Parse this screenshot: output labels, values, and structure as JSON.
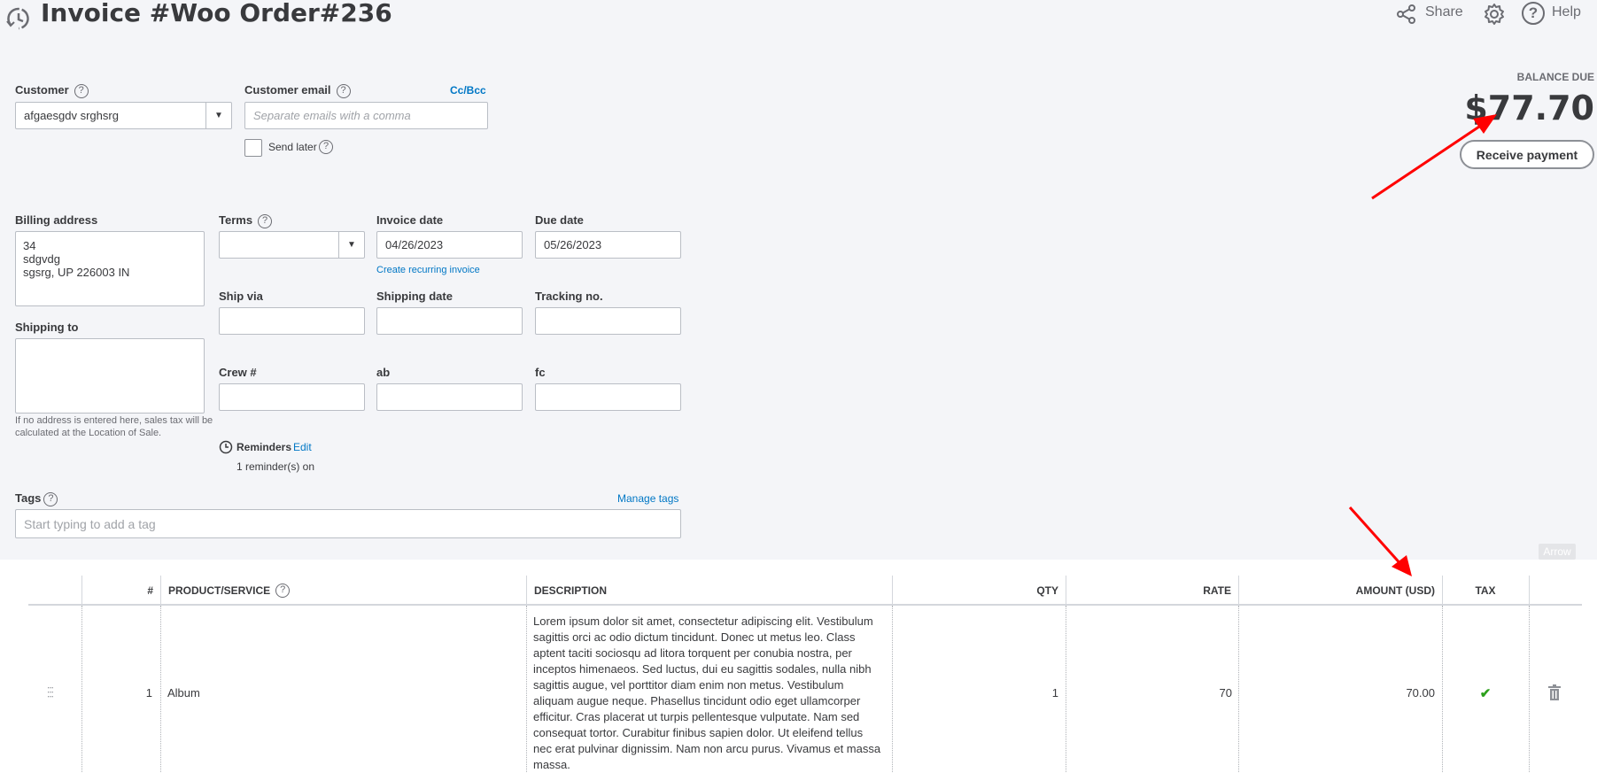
{
  "header": {
    "title": "Invoice #Woo Order#236",
    "share": "Share",
    "help": "Help",
    "icons": [
      "history-icon",
      "share-icon",
      "gear-icon",
      "help-icon"
    ]
  },
  "balance": {
    "label": "BALANCE DUE",
    "amount": "$77.70",
    "receive_payment": "Receive payment"
  },
  "customer": {
    "label": "Customer",
    "value": "afgaesgdv srghsrg"
  },
  "email": {
    "label": "Customer email",
    "placeholder": "Separate emails with a comma",
    "cc_bcc": "Cc/Bcc",
    "send_later": "Send later",
    "send_later_checked": false
  },
  "billing": {
    "label": "Billing address",
    "lines": [
      "34",
      "sdgvdg",
      "sgsrg, UP  226003 IN"
    ]
  },
  "shipping_to": {
    "label": "Shipping to",
    "value": "",
    "note": "If no address is entered here, sales tax will be calculated at the Location of Sale."
  },
  "terms": {
    "label": "Terms",
    "value": ""
  },
  "invoice_date": {
    "label": "Invoice date",
    "value": "04/26/2023",
    "recurring_link": "Create recurring invoice"
  },
  "due_date": {
    "label": "Due date",
    "value": "05/26/2023"
  },
  "ship_via": {
    "label": "Ship via",
    "value": ""
  },
  "shipping_date": {
    "label": "Shipping date",
    "value": ""
  },
  "tracking": {
    "label": "Tracking no.",
    "value": ""
  },
  "crew": {
    "label": "Crew #",
    "value": ""
  },
  "ab": {
    "label": "ab",
    "value": ""
  },
  "fc": {
    "label": "fc",
    "value": ""
  },
  "reminders": {
    "label": "Reminders",
    "edit": "Edit",
    "status": "1 reminder(s) on"
  },
  "tags": {
    "label": "Tags",
    "manage": "Manage tags",
    "placeholder": "Start typing to add a tag"
  },
  "arrow_button": "Arrow",
  "table": {
    "columns": [
      "#",
      "PRODUCT/SERVICE",
      "DESCRIPTION",
      "QTY",
      "RATE",
      "AMOUNT (USD)",
      "TAX"
    ],
    "rows": [
      {
        "num": "1",
        "product": "Album",
        "description_lines": [
          "Lorem ipsum dolor sit amet, consectetur adipiscing elit. Vestibulum",
          "sagittis orci ac odio dictum tincidunt. Donec ut metus leo. Class",
          "aptent taciti sociosqu ad litora torquent per conubia nostra, per",
          "inceptos himenaeos. Sed luctus, dui eu sagittis sodales, nulla nibh",
          "sagittis augue, vel porttitor diam enim non metus. Vestibulum",
          "aliquam augue neque. Phasellus tincidunt odio eget ullamcorper",
          "efficitur. Cras placerat ut turpis pellentesque vulputate. Nam sed",
          "consequat tortor. Curabitur finibus sapien dolor. Ut eleifend tellus",
          "nec erat pulvinar dignissim. Nam non arcu purus. Vivamus et massa",
          "massa."
        ],
        "qty": "1",
        "rate": "70",
        "amount": "70.00",
        "taxable": true
      }
    ]
  },
  "colors": {
    "accent_link": "#0077c5",
    "tax_check": "#2ca01c",
    "annotation_arrow": "#ff0000"
  }
}
